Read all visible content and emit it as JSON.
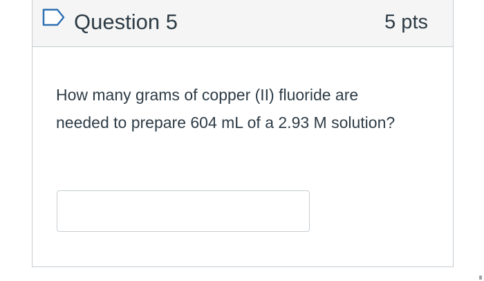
{
  "question": {
    "title": "Question 5",
    "points": "5 pts",
    "flag_icon": "flag-outline-icon",
    "text": "How many grams of copper (II) fluoride are needed to prepare 604 mL of a 2.93 M solution?",
    "answer_value": "",
    "answer_placeholder": ""
  },
  "colors": {
    "header_background": "#f5f5f5",
    "border": "#c7cdd1",
    "text": "#2d3b45",
    "flag_icon": "#2d6fb3"
  }
}
